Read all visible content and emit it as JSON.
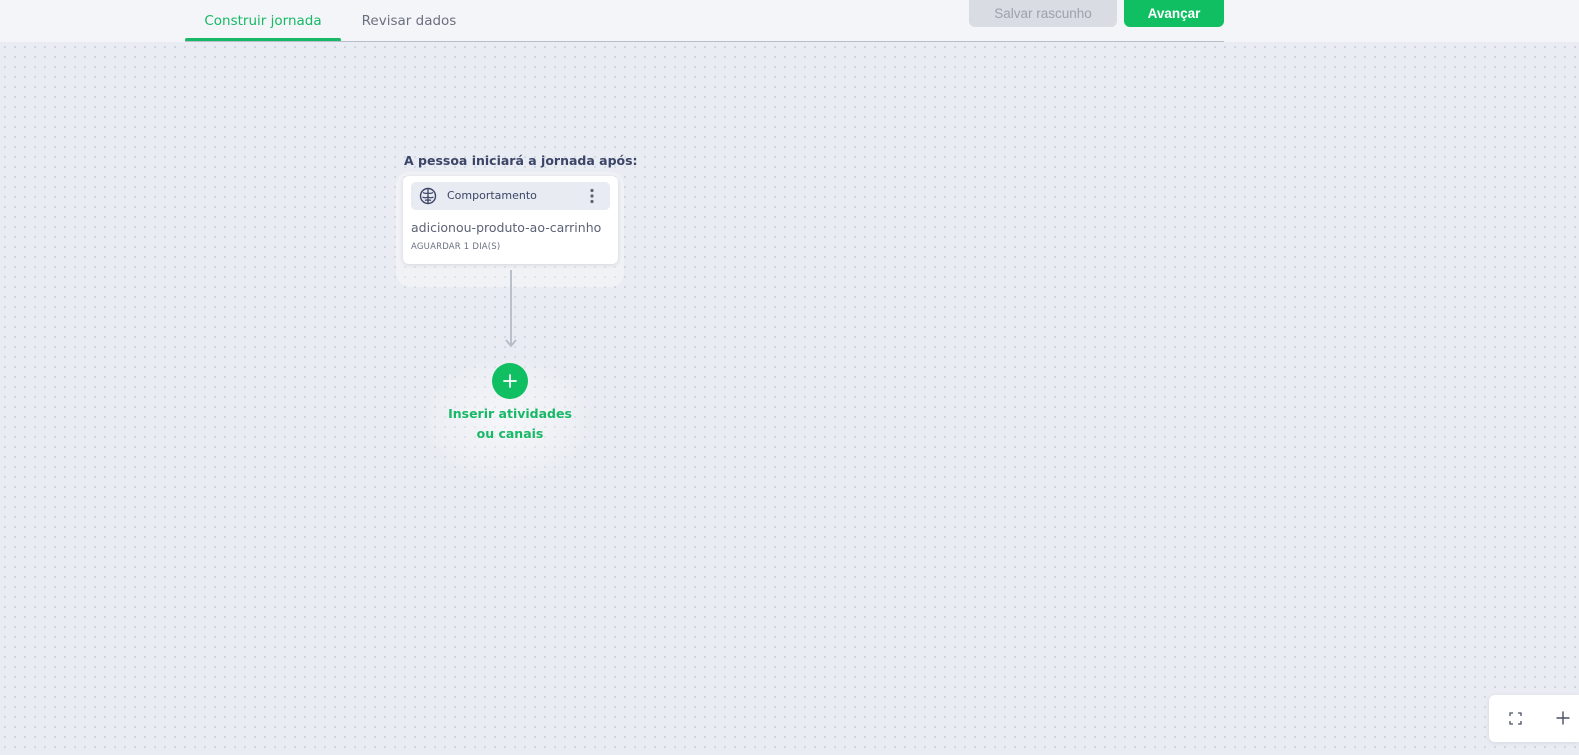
{
  "tabs": [
    {
      "label": "Construir jornada",
      "active": true
    },
    {
      "label": "Revisar dados",
      "active": false
    }
  ],
  "toolbar": {
    "save_draft_label": "Salvar rascunho",
    "next_label": "Avançar"
  },
  "journey": {
    "start_label": "A pessoa iniciará a jornada após:",
    "trigger": {
      "type_label": "Comportamento",
      "type_icon": "brain-icon",
      "event": "adicionou-produto-ao-carrinho",
      "wait_label": "AGUARDAR 1 DIA(S)"
    },
    "add_step_label_line1": "Inserir atividades",
    "add_step_label_line2": "ou canais"
  },
  "colors": {
    "accent": "#0fbf62",
    "accent_text": "#17b866",
    "canvas_bg": "#e9ecf2",
    "text_dark": "#3c4567"
  }
}
